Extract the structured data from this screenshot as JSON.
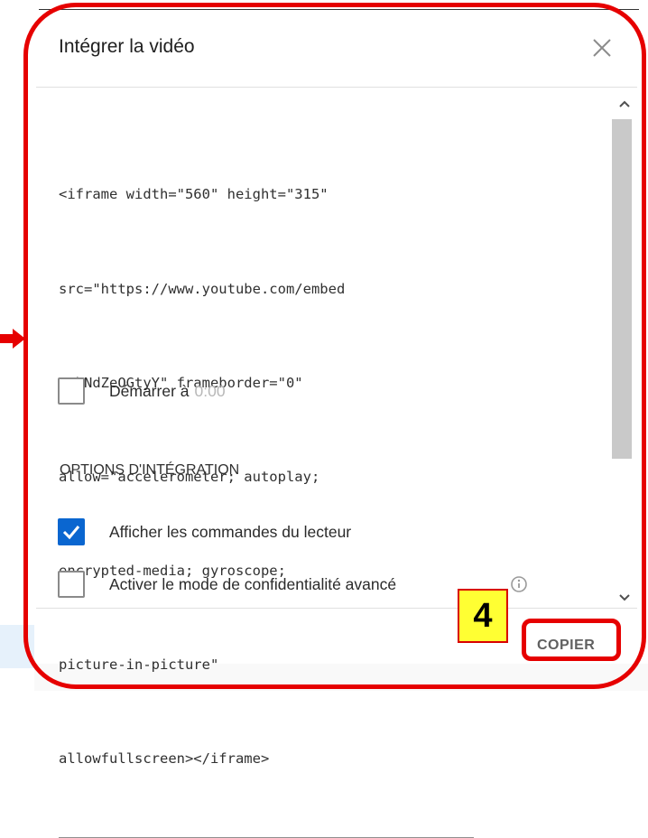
{
  "dialog": {
    "title": "Intégrer la vidéo",
    "embed_code_lines": [
      "<iframe width=\"560\" height=\"315\"",
      "src=\"https://www.youtube.com/embed",
      "/YhNdZeOGtyY\" frameborder=\"0\"",
      "allow=\"accelerometer; autoplay;",
      "encrypted-media; gyroscope;",
      "picture-in-picture\"",
      "allowfullscreen></iframe>"
    ],
    "start_at": {
      "label": "Démarrer à",
      "value": "0:00",
      "checked": false
    },
    "options_title": "OPTIONS D'INTÉGRATION",
    "options": [
      {
        "label": "Afficher les commandes du lecteur",
        "checked": true
      },
      {
        "label": "Activer le mode de confidentialité avancé",
        "checked": false
      }
    ],
    "copy_label": "COPIER"
  },
  "annotation": {
    "step_number": "4",
    "highlight_color": "#e60000",
    "label_color": "#ffff33"
  },
  "colors": {
    "checkbox_checked": "#0a66d0",
    "scrollbar": "#c9c9c9"
  },
  "icons": {
    "close": "close-icon",
    "check": "check-icon",
    "info": "info-icon",
    "scroll_up": "chevron-up-icon",
    "scroll_down": "chevron-down-icon"
  }
}
